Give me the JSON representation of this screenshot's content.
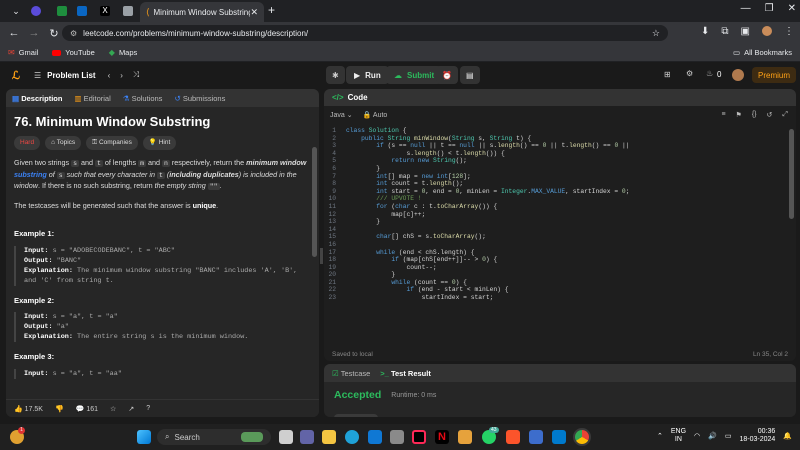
{
  "browser": {
    "active_tab_title": "Minimum Window Substring - Le...",
    "new_tab_symbol": "+",
    "url": "leetcode.com/problems/minimum-window-substring/description/",
    "bookmarks": [
      "Gmail",
      "YouTube",
      "Maps"
    ],
    "all_bookmarks": "All Bookmarks",
    "mini_tabs": [
      {
        "name": "copilot",
        "color": "#5b4cdb"
      },
      {
        "name": "mail",
        "color": "#7b3fe4"
      },
      {
        "name": "sheets",
        "color": "#1e8e3e"
      },
      {
        "name": "linkedin",
        "color": "#0a66c2"
      },
      {
        "name": "x",
        "color": "#111111"
      },
      {
        "name": "generic",
        "color": "#9aa0a6"
      }
    ]
  },
  "lc_header": {
    "problem_list": "Problem List",
    "run": "Run",
    "submit": "Submit",
    "notifications": "0",
    "premium": "Premium"
  },
  "left_tabs": [
    "Description",
    "Editorial",
    "Solutions",
    "Submissions"
  ],
  "problem": {
    "title": "76. Minimum Window Substring",
    "difficulty": "Hard",
    "tags": [
      "Topics",
      "Companies",
      "Hint"
    ],
    "desc": {
      "p1a": "Given two strings ",
      "s": "s",
      "and": " and ",
      "t": "t",
      "p1b": " of lengths ",
      "m": "m",
      "and2": " and ",
      "n": "n",
      "p1c": " respectively, return the ",
      "b1": "minimum window",
      "link": "substring",
      "p1d": " of ",
      "p1e": " such that every character in ",
      "p1f": " (",
      "b2": "including duplicates",
      "p1g": ") is included in the window",
      "p1h": ". If there is no such substring, return ",
      "i1": "the empty string",
      "empty": "\"\"",
      "p1i": ".",
      "p2a": "The testcases will be generated such that the answer is ",
      "b3": "unique",
      "p2b": "."
    },
    "examples": [
      {
        "title": "Example 1:",
        "input": "s = \"ADOBECODEBANC\", t = \"ABC\"",
        "output": "\"BANC\"",
        "explanation": "The minimum window substring \"BANC\" includes 'A', 'B', and 'C' from string t."
      },
      {
        "title": "Example 2:",
        "input": "s = \"a\", t = \"a\"",
        "output": "\"a\"",
        "explanation": "The entire string s is the minimum window."
      },
      {
        "title": "Example 3:",
        "input": "s = \"a\", t = \"aa\""
      }
    ],
    "labels": {
      "input": "Input:",
      "output": "Output:",
      "explanation": "Explanation:"
    }
  },
  "left_footer": {
    "likes": "17.5K",
    "comments": "161"
  },
  "code": {
    "header": "Code",
    "language": "Java",
    "mode": "Auto",
    "status_left": "Saved to local",
    "status_right": "Ln 35, Col 2",
    "lines": [
      [
        [
          "kw",
          "class "
        ],
        [
          "ty",
          "Solution "
        ],
        [
          "tx",
          "{"
        ]
      ],
      [
        [
          "tx",
          "    "
        ],
        [
          "kw",
          "public "
        ],
        [
          "ty",
          "String "
        ],
        [
          "fn",
          "minWindow"
        ],
        [
          "tx",
          "("
        ],
        [
          "ty",
          "String "
        ],
        [
          "tx",
          "s, "
        ],
        [
          "ty",
          "String "
        ],
        [
          "tx",
          "t) {"
        ]
      ],
      [
        [
          "tx",
          "        "
        ],
        [
          "kw",
          "if "
        ],
        [
          "tx",
          "(s == "
        ],
        [
          "kw",
          "null "
        ],
        [
          "tx",
          "|| t == "
        ],
        [
          "kw",
          "null "
        ],
        [
          "tx",
          "|| s."
        ],
        [
          "fn",
          "length"
        ],
        [
          "tx",
          "() == "
        ],
        [
          "nu",
          "0 "
        ],
        [
          "tx",
          "|| t."
        ],
        [
          "fn",
          "length"
        ],
        [
          "tx",
          "() == "
        ],
        [
          "nu",
          "0 "
        ],
        [
          "tx",
          "||"
        ]
      ],
      [
        [
          "tx",
          "                s."
        ],
        [
          "fn",
          "length"
        ],
        [
          "tx",
          "() < t."
        ],
        [
          "fn",
          "length"
        ],
        [
          "tx",
          "()) {"
        ]
      ],
      [
        [
          "tx",
          "            "
        ],
        [
          "kw",
          "return new "
        ],
        [
          "ty",
          "String"
        ],
        [
          "tx",
          "();"
        ]
      ],
      [
        [
          "tx",
          "        }"
        ]
      ],
      [
        [
          "tx",
          "        "
        ],
        [
          "kw",
          "int"
        ],
        [
          "tx",
          "[] map = "
        ],
        [
          "kw",
          "new int"
        ],
        [
          "tx",
          "["
        ],
        [
          "nu",
          "128"
        ],
        [
          "tx",
          "];"
        ]
      ],
      [
        [
          "tx",
          "        "
        ],
        [
          "kw",
          "int "
        ],
        [
          "tx",
          "count = t."
        ],
        [
          "fn",
          "length"
        ],
        [
          "tx",
          "();"
        ]
      ],
      [
        [
          "tx",
          "        "
        ],
        [
          "kw",
          "int "
        ],
        [
          "tx",
          "start = "
        ],
        [
          "nu",
          "0"
        ],
        [
          "tx",
          ", end = "
        ],
        [
          "nu",
          "0"
        ],
        [
          "tx",
          ", minLen = "
        ],
        [
          "ty",
          "Integer"
        ],
        [
          "tx",
          "."
        ],
        [
          "kw",
          "MAX_VALUE"
        ],
        [
          "tx",
          ", startIndex = "
        ],
        [
          "nu",
          "0"
        ],
        [
          "tx",
          ";"
        ]
      ],
      [
        [
          "tx",
          "        "
        ],
        [
          "cm",
          "/// UPVOTE !"
        ]
      ],
      [
        [
          "tx",
          "        "
        ],
        [
          "kw",
          "for "
        ],
        [
          "tx",
          "("
        ],
        [
          "kw",
          "char "
        ],
        [
          "tx",
          "c : t."
        ],
        [
          "fn",
          "toCharArray"
        ],
        [
          "tx",
          "()) {"
        ]
      ],
      [
        [
          "tx",
          "            map[c]++;"
        ]
      ],
      [
        [
          "tx",
          "        }"
        ]
      ],
      [
        [
          "tx",
          ""
        ]
      ],
      [
        [
          "tx",
          "        "
        ],
        [
          "kw",
          "char"
        ],
        [
          "tx",
          "[] chS = s."
        ],
        [
          "fn",
          "toCharArray"
        ],
        [
          "tx",
          "();"
        ]
      ],
      [
        [
          "tx",
          ""
        ]
      ],
      [
        [
          "tx",
          "        "
        ],
        [
          "kw",
          "while "
        ],
        [
          "tx",
          "(end < chS.length) {"
        ]
      ],
      [
        [
          "tx",
          "            "
        ],
        [
          "kw",
          "if "
        ],
        [
          "tx",
          "(map[chS[end++]]-- > "
        ],
        [
          "nu",
          "0"
        ],
        [
          "tx",
          ") {"
        ]
      ],
      [
        [
          "tx",
          "                count--;"
        ]
      ],
      [
        [
          "tx",
          "            }"
        ]
      ],
      [
        [
          "tx",
          "            "
        ],
        [
          "kw",
          "while "
        ],
        [
          "tx",
          "(count == "
        ],
        [
          "nu",
          "0"
        ],
        [
          "tx",
          ") {"
        ]
      ],
      [
        [
          "tx",
          "                "
        ],
        [
          "kw",
          "if "
        ],
        [
          "tx",
          "(end - start < minLen) {"
        ]
      ],
      [
        [
          "tx",
          "                    startIndex = start;"
        ]
      ]
    ]
  },
  "test": {
    "tabs": [
      "Testcase",
      "Test Result"
    ],
    "result": "Accepted",
    "runtime": "Runtime: 0 ms"
  },
  "taskbar": {
    "search": "Search",
    "lang": "ENG",
    "region": "IN",
    "time": "00:36",
    "date": "18-03-2024",
    "badge_left": "1",
    "badge_mid": "43"
  }
}
